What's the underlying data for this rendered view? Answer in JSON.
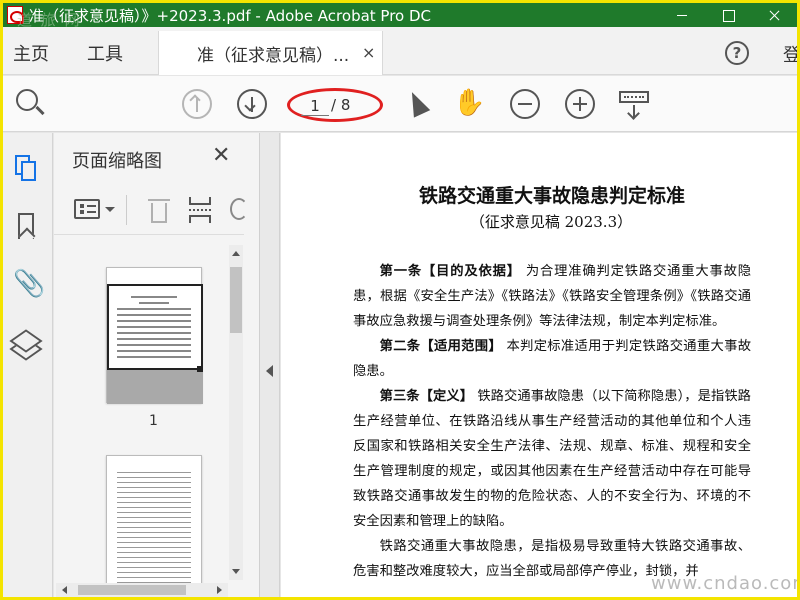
{
  "window": {
    "title": "准（征求意见稿）》+2023.3.pdf - Adobe Acrobat Pro DC",
    "watermark": "道 旅 网"
  },
  "tabs": {
    "home": "主页",
    "tools": "工具",
    "document": "准（征求意见稿）...",
    "close_glyph": "×",
    "help_glyph": "?",
    "signin": "登"
  },
  "toolbar": {
    "current_page": "1",
    "total_pages": "/ 8",
    "hand_glyph": "✋"
  },
  "rail": {
    "attach_glyph": "📎"
  },
  "panel": {
    "title": "页面缩略图",
    "close_glyph": "✕",
    "thumb1_label": "1"
  },
  "document": {
    "title": "铁路交通重大事故隐患判定标准",
    "subtitle": "（征求意见稿 2023.3）",
    "para1_head": "第一条【目的及依据】",
    "para1_text": "为合理准确判定铁路交通重大事故隐患，根据《安全生产法》《铁路法》《铁路安全管理条例》《铁路交通事故应急救援与调查处理条例》等法律法规，制定本判定标准。",
    "para2_head": "第二条【适用范围】",
    "para2_text": "本判定标准适用于判定铁路交通重大事故隐患。",
    "para3_head": "第三条【定义】",
    "para3_text": "铁路交通事故隐患（以下简称隐患），是指铁路生产经营单位、在铁路沿线从事生产经营活动的其他单位和个人违反国家和铁路相关安全生产法律、法规、规章、标准、规程和安全生产管理制度的规定，或因其他因素在生产经营活动中存在可能导致铁路交通事故发生的物的危险状态、人的不安全行为、环境的不安全因素和管理上的缺陷。",
    "para4_text": "铁路交通重大事故隐患，是指极易导致重特大铁路交通事故、危害和整改难度较大，应当全部或局部停产停业，封锁，并"
  },
  "site_watermark": "www.cndao.com",
  "colors": {
    "titlebar": "#1f7a2b",
    "accent": "#1473e6",
    "annotation": "#e02020",
    "frame": "#f4e400"
  }
}
